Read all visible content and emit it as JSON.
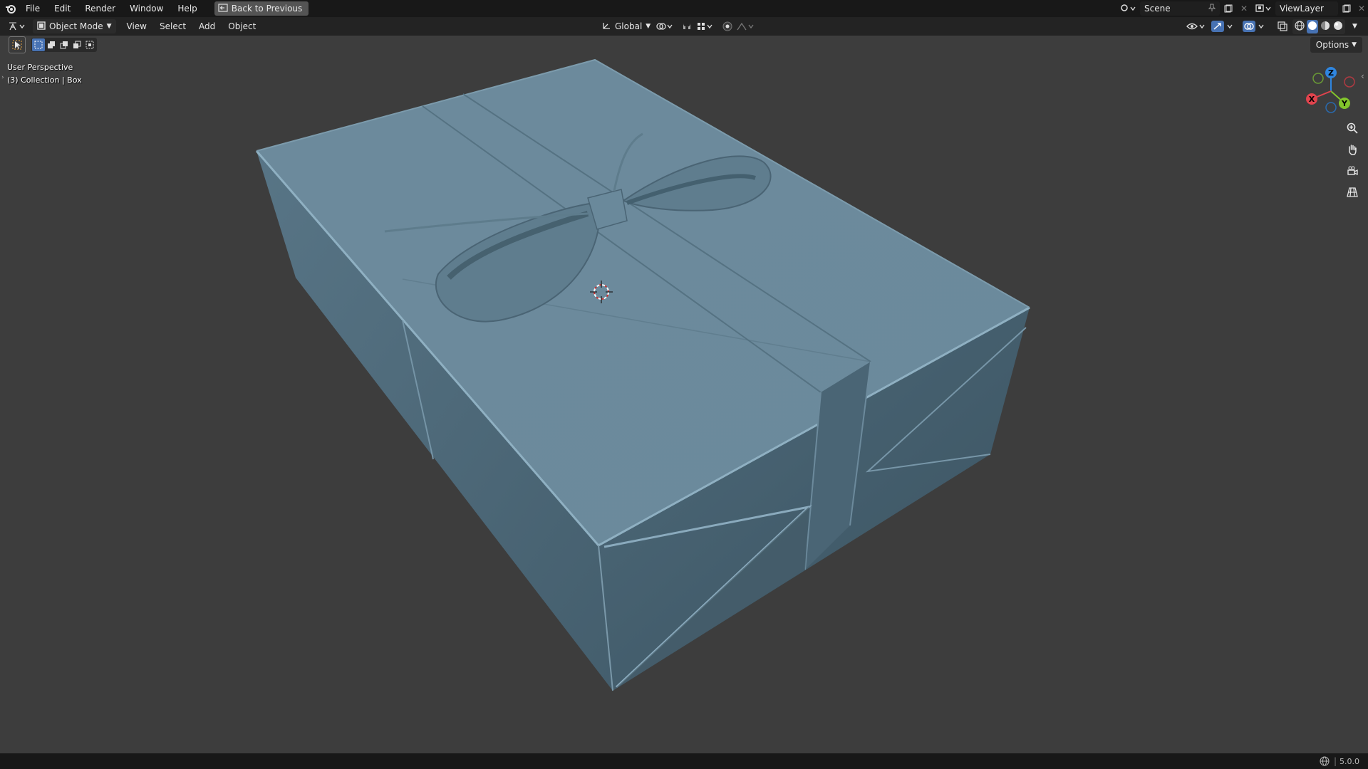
{
  "menu": {
    "items": [
      "File",
      "Edit",
      "Render",
      "Window",
      "Help"
    ],
    "back_label": "Back to Previous"
  },
  "scene": {
    "name": "Scene",
    "view_layer": "ViewLayer"
  },
  "header": {
    "mode": "Object Mode",
    "menus": [
      "View",
      "Select",
      "Add",
      "Object"
    ],
    "transform_orientation": "Global",
    "options_label": "Options"
  },
  "viewport": {
    "perspective_label": "User Perspective",
    "collection_label": "(3) Collection | Box",
    "object_color": "#6f8fa1"
  },
  "gizmo": {
    "x": "X",
    "y": "Y",
    "z": "Z"
  },
  "status": {
    "version": "5.0.0"
  },
  "colors": {
    "axis_x": "#e0434d",
    "axis_y": "#82c42c",
    "axis_z": "#2f86e0",
    "accent": "#4772b3"
  }
}
